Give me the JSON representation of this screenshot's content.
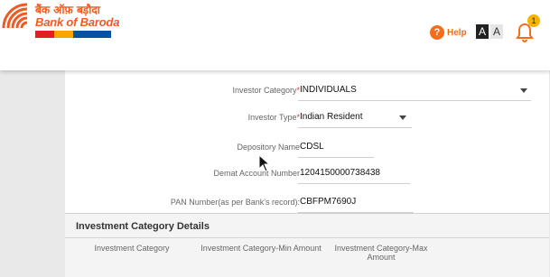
{
  "header": {
    "logo_hindi": "बैंक ऑफ़ बड़ौदा",
    "logo_english": "Bank of Baroda",
    "help_label": "Help",
    "font_large_label": "A",
    "font_small_label": "A",
    "notification_count": "1",
    "brand_color": "#f15a22"
  },
  "form": {
    "investor_category": {
      "label": "Investor Category",
      "required_mark": "*",
      "value": "INDIVIDUALS"
    },
    "investor_type": {
      "label": "Investor Type",
      "required_mark": "*",
      "value": "Indian Resident"
    },
    "depository_name": {
      "label": "Depository Name",
      "value": "CDSL"
    },
    "demat_account_number": {
      "label": "Demat Account Number",
      "value": "1204150000738438"
    },
    "pan_number": {
      "label": "PAN Number(as per Bank's record):",
      "value": "CBFPM7690J"
    }
  },
  "investment_section": {
    "title": "Investment Category Details",
    "columns": [
      "Investment Category",
      "Investment Category-Min Amount",
      "Investment Category-Max\nAmount"
    ]
  }
}
